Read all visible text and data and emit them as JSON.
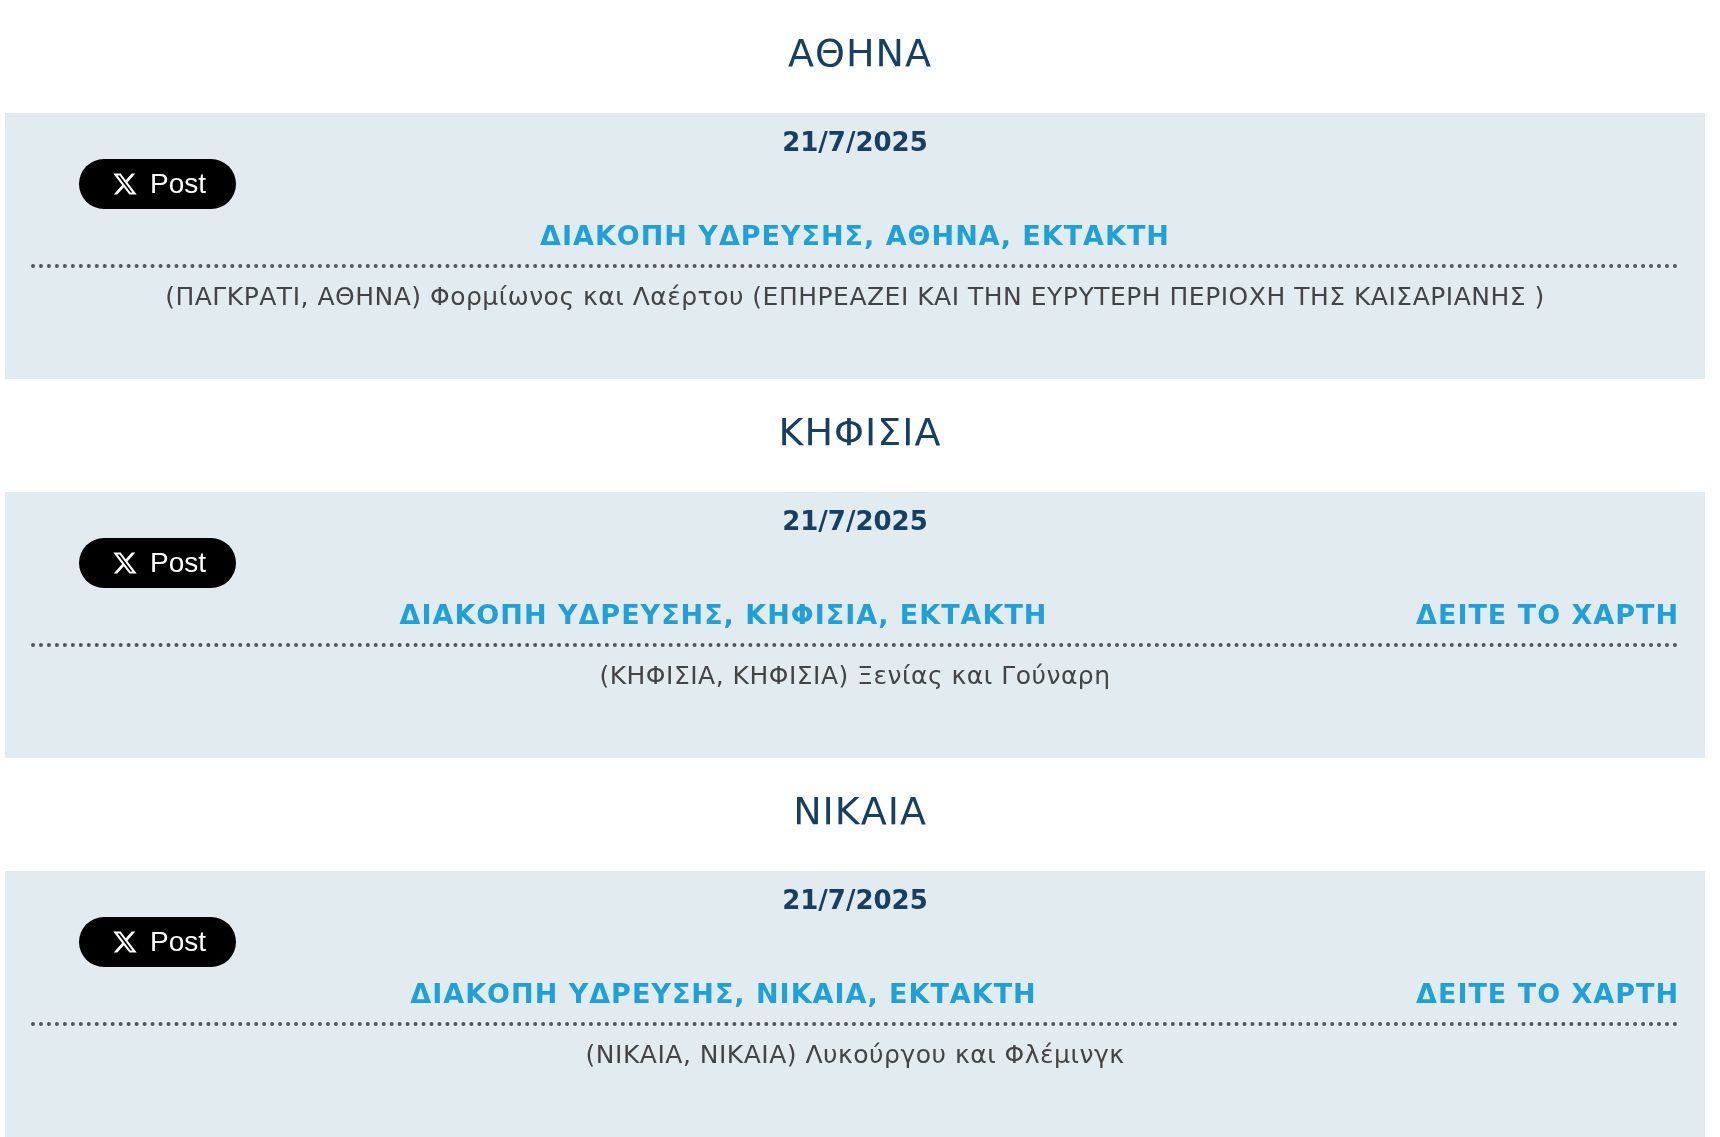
{
  "sections": [
    {
      "city": "ΑΘΗΝΑ",
      "date": "21/7/2025",
      "post_label": "Post",
      "title": "ΔΙΑΚΟΠΗ ΥΔΡΕΥΣΗΣ, ΑΘΗΝΑ, ΕΚΤΑΚΤΗ",
      "description": "(ΠΑΓΚΡΑΤΙ, ΑΘΗΝΑ) Φορμίωνος και Λαέρτου (ΕΠΗΡΕΑΖΕΙ ΚΑΙ ΤΗΝ ΕΥΡΥΤΕΡΗ ΠΕΡΙΟΧΗ ΤΗΣ ΚΑΙΣΑΡΙΑΝΗΣ )"
    },
    {
      "city": "ΚΗΦΙΣΙΑ",
      "date": "21/7/2025",
      "post_label": "Post",
      "title": "ΔΙΑΚΟΠΗ ΥΔΡΕΥΣΗΣ, ΚΗΦΙΣΙΑ, ΕΚΤΑΚΤΗ",
      "map_link": "ΔΕΙΤΕ ΤΟ ΧΑΡΤΗ",
      "description": "(ΚΗΦΙΣΙΑ, ΚΗΦΙΣΙΑ) Ξενίας και Γούναρη"
    },
    {
      "city": "ΝΙΚΑΙΑ",
      "date": "21/7/2025",
      "post_label": "Post",
      "title": "ΔΙΑΚΟΠΗ ΥΔΡΕΥΣΗΣ, ΝΙΚΑΙΑ, ΕΚΤΑΚΤΗ",
      "map_link": "ΔΕΙΤΕ ΤΟ ΧΑΡΤΗ",
      "description": "(ΝΙΚΑΙΑ, ΝΙΚΑΙΑ) Λυκούργου και Φλέμινγκ"
    }
  ]
}
